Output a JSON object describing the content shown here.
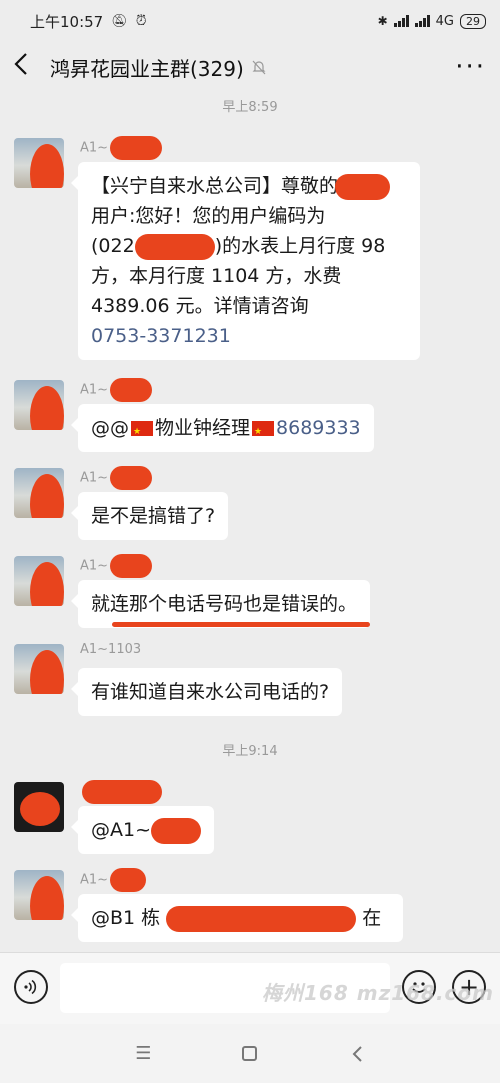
{
  "status": {
    "time": "上午10:57",
    "network": "4G",
    "battery": "29"
  },
  "header": {
    "title": "鸿昇花园业主群(329)",
    "back_icon": "back-arrow-icon",
    "mute_icon": "bell-muted-icon",
    "more_icon": "more-icon"
  },
  "timestamps": [
    "早上8:59",
    "早上9:14"
  ],
  "messages": [
    {
      "sender": "A1~",
      "lines": [
        "【兴宁自来水总公司】尊敬的廖",
        "用户:您好！您的用户编码为",
        "(022",
        ")的水表上月行度 98",
        "方，本月行度 1104 方，水费",
        "4389.06 元。详情请咨询"
      ],
      "phone": "0753-3371231"
    },
    {
      "sender": "A1~",
      "prefix": "@@",
      "mid": "物业钟经理",
      "suffix": "8689333"
    },
    {
      "sender": "A1~",
      "text": "是不是搞错了?"
    },
    {
      "sender": "A1~",
      "text": "就连那个电话号码也是错误的。"
    },
    {
      "sender": "A1~1103",
      "text": "有谁知道自来水公司电话的?"
    },
    {
      "sender": "",
      "text": "@A1~"
    },
    {
      "sender": "A1~",
      "prefix": "@B1 栋",
      "suffix": "在"
    }
  ],
  "input": {
    "value": "",
    "voice_icon": "voice-icon",
    "emoji_icon": "emoji-icon",
    "plus_icon": "plus-icon"
  },
  "watermark": "梅州168 mz168.com",
  "nav": {
    "menu_icon": "menu-icon",
    "home_icon": "home-icon",
    "back_icon": "back-icon"
  },
  "colors": {
    "redaction": "#e8441d",
    "phone_link": "#4a5f88",
    "bubble": "#ffffff",
    "background": "#ededed"
  }
}
